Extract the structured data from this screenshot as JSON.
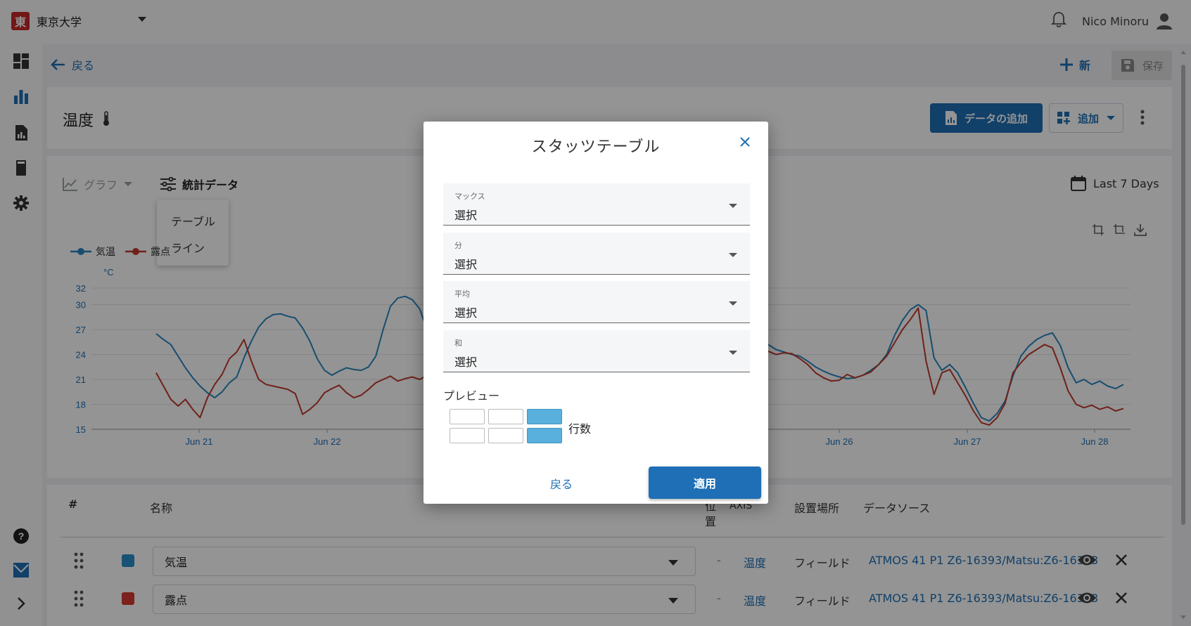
{
  "header": {
    "brand_logo": "東",
    "brand_name": "東京大学",
    "user_name": "Nico Minoru"
  },
  "sidebar": {
    "items": [
      {
        "icon": "dashboard-icon"
      },
      {
        "icon": "bar-chart-icon",
        "active": true
      },
      {
        "icon": "report-icon"
      },
      {
        "icon": "device-icon"
      },
      {
        "icon": "gear-icon"
      },
      {
        "icon": "help-icon"
      },
      {
        "icon": "chart-logo-icon"
      },
      {
        "icon": "chevron-right-icon"
      }
    ]
  },
  "toolbar": {
    "back_label": "戻る",
    "new_label": "新",
    "save_label": "保存"
  },
  "page": {
    "title": "温度",
    "add_data_label": "データの追加",
    "add_label": "追加"
  },
  "chart_panel": {
    "graph_tab": "グラフ",
    "stats_tab": "統計データ",
    "date_range": "Last 7 Days",
    "menu_items": [
      "テーブル",
      "ライン"
    ]
  },
  "chart_data": {
    "type": "line",
    "ylabel": "°C",
    "ylim": [
      15,
      32
    ],
    "yticks": [
      15,
      18,
      21,
      24,
      27,
      30,
      32
    ],
    "xticks": [
      "Jun 21",
      "Jun 22",
      "Jun 26",
      "Jun 27",
      "Jun 28"
    ],
    "grid": true,
    "legend_position": "top-left",
    "series": [
      {
        "name": "気温",
        "color": "#2a86bf",
        "values": [
          26.5,
          25.8,
          25.2,
          23.8,
          22.4,
          21.2,
          20.2,
          19.4,
          18.8,
          19.5,
          20.6,
          21.3,
          23.6,
          25.6,
          27.3,
          28.3,
          28.8,
          28.9,
          28.6,
          28.4,
          27.2,
          25.6,
          23.5,
          22.1,
          21.5,
          22.0,
          22.4,
          22.2,
          22.1,
          22.5,
          23.8,
          27.0,
          29.8,
          30.8,
          31.0,
          30.6,
          29.5,
          27.0
        ]
      },
      {
        "name": "露点",
        "color": "#c0392b",
        "values": [
          21.8,
          20.2,
          18.6,
          17.8,
          18.6,
          17.4,
          16.4,
          18.8,
          20.4,
          21.6,
          23.5,
          24.3,
          25.8,
          23.2,
          21.0,
          20.4,
          20.2,
          20.0,
          19.8,
          19.3,
          16.8,
          17.4,
          18.2,
          19.4,
          19.9,
          20.3,
          19.4,
          18.8,
          19.1,
          19.8,
          20.6,
          21.0,
          21.4,
          20.8,
          21.1,
          21.3,
          21.0,
          21.5
        ]
      },
      {
        "name": "気温",
        "color": "#2a86bf",
        "values": [
          25.2,
          24.6,
          24.3,
          24.0,
          23.8,
          23.2,
          22.5,
          22.0,
          21.6,
          21.3,
          21.1,
          21.2,
          21.5,
          22.1,
          22.8,
          24.0,
          26.3,
          28.1,
          29.4,
          30.0,
          29.3,
          23.6,
          22.1,
          22.8,
          21.8,
          20.0,
          18.1,
          16.4,
          16.0,
          16.9,
          18.4,
          21.4,
          23.8,
          25.0,
          25.8,
          26.3,
          26.6,
          25.1,
          22.4,
          20.6,
          21.0,
          20.4,
          20.8,
          20.2,
          19.9,
          20.4
        ]
      },
      {
        "name": "露点",
        "color": "#c0392b",
        "values": [
          24.4,
          24.0,
          24.2,
          24.1,
          23.5,
          22.8,
          21.8,
          21.2,
          20.8,
          20.9,
          21.6,
          21.2,
          21.5,
          21.9,
          22.8,
          23.8,
          25.4,
          27.0,
          28.2,
          29.6,
          23.2,
          19.2,
          21.8,
          22.2,
          20.6,
          19.0,
          17.2,
          15.8,
          15.5,
          16.4,
          18.1,
          21.8,
          23.0,
          24.0,
          24.6,
          25.2,
          24.8,
          22.4,
          19.6,
          18.0,
          17.6,
          17.9,
          17.4,
          17.7,
          17.2,
          17.5
        ]
      }
    ]
  },
  "table": {
    "headers": {
      "num": "#",
      "name": "名称",
      "position": "位\n置",
      "axis": "AXIS",
      "location": "設置場所",
      "source": "データソース"
    },
    "rows": [
      {
        "color": "#2a8fca",
        "name": "気温",
        "position": "-",
        "axis": "温度",
        "location": "フィールド",
        "source": "ATMOS 41 P1 Z6-16393/Matsu:Z6-16393"
      },
      {
        "color": "#d63a2f",
        "name": "露点",
        "position": "-",
        "axis": "温度",
        "location": "フィールド",
        "source": "ATMOS 41 P1 Z6-16393/Matsu:Z6-16393"
      }
    ]
  },
  "modal": {
    "title": "スタッツテーブル",
    "fields": [
      {
        "label": "マックス",
        "value": "選択"
      },
      {
        "label": "分",
        "value": "選択"
      },
      {
        "label": "平均",
        "value": "選択"
      },
      {
        "label": "和",
        "value": "選択"
      }
    ],
    "preview_label": "プレビュー",
    "rows_label": "行数",
    "back_label": "戻る",
    "apply_label": "適用"
  }
}
